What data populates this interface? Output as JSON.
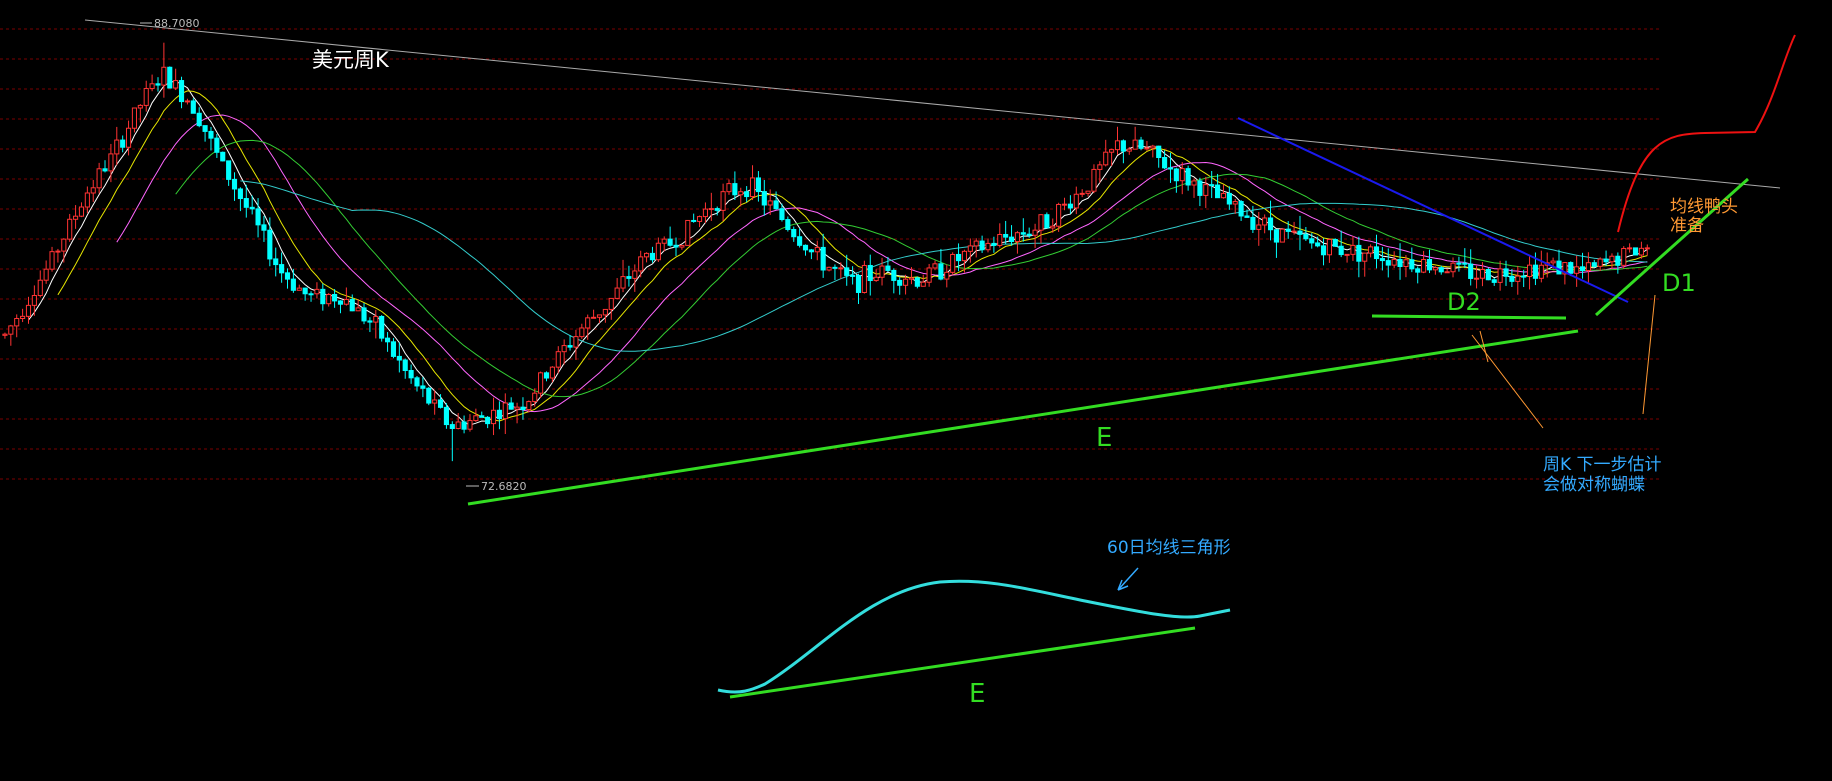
{
  "chart_data": {
    "type": "candlestick",
    "title": "美元周K",
    "period": "weekly",
    "grid": true,
    "y_axis_visible": false,
    "price_labels": {
      "high": "88.7080",
      "low": "72.6820"
    },
    "ylim": [
      71.5,
      89.5
    ],
    "num_bars": 280,
    "candles": [],
    "moving_averages": [
      {
        "color": "#ffffff",
        "window": 5
      },
      {
        "color": "#e6e600",
        "window": 10
      },
      {
        "color": "#ff66ff",
        "window": 20
      },
      {
        "color": "#33cc33",
        "window": 30
      },
      {
        "color": "#33cccc",
        "window": 60
      }
    ],
    "colors": {
      "up": "#ff3333",
      "down": "#00ffff",
      "background": "#000000",
      "grid": "#7a0000"
    }
  },
  "annotations": {
    "title": "美元周K",
    "high_label": "88.7080",
    "low_label": "72.6820",
    "label_E": "E",
    "label_D2": "D2",
    "label_D1": "D1",
    "label_E_small": "E",
    "note_ma_head": [
      "均线鸭头",
      "准备"
    ],
    "note_weekly": [
      "周K  下一步估计",
      "会做对称蝴蝶"
    ],
    "note_60ma": "60日均线三角形"
  },
  "colors": {
    "green_line": "#33dd22",
    "blue_line": "#1a1aee",
    "red_curve": "#ee1111",
    "orange_note": "#ff9933",
    "cyan_note": "#33aaff",
    "cyan_curve": "#33dddd",
    "trend_gray": "#aaaaaa"
  }
}
